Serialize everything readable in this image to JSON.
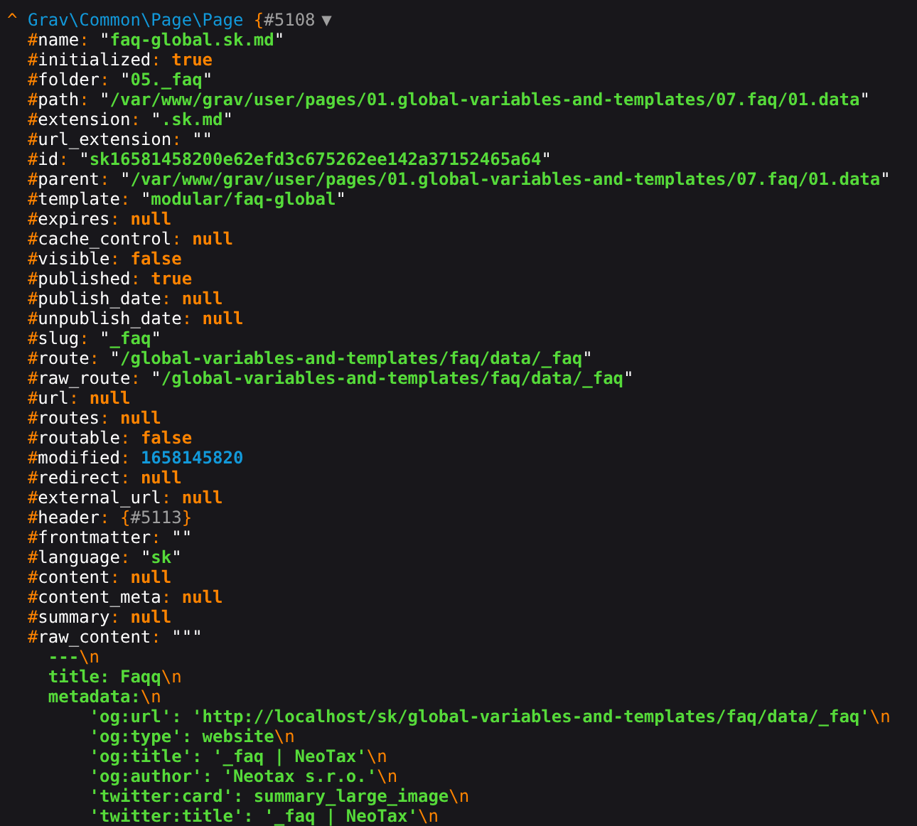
{
  "dump": {
    "caret": "^",
    "class": "Grav\\Common\\Page\\Page",
    "ref": "{#5108",
    "toggle": "▼",
    "properties": [
      {
        "key": "#name:",
        "value": "\"faq-global.sk.md\"",
        "kind": "string"
      },
      {
        "key": "#initialized:",
        "value": "true",
        "kind": "const"
      },
      {
        "key": "#folder:",
        "value": "\"05._faq\"",
        "kind": "string"
      },
      {
        "key": "#path:",
        "value": "\"/var/www/grav/user/pages/01.global-variables-and-templates/07.faq/01.data\"",
        "kind": "string"
      },
      {
        "key": "#extension:",
        "value": "\".sk.md\"",
        "kind": "string"
      },
      {
        "key": "#url_extension:",
        "value": "\"\"",
        "kind": "string"
      },
      {
        "key": "#id:",
        "value": "\"sk16581458200e62efd3c675262ee142a37152465a64\"",
        "kind": "string"
      },
      {
        "key": "#parent:",
        "value": "\"/var/www/grav/user/pages/01.global-variables-and-templates/07.faq/01.data\"",
        "kind": "string"
      },
      {
        "key": "#template:",
        "value": "\"modular/faq-global\"",
        "kind": "string"
      },
      {
        "key": "#expires:",
        "value": "null",
        "kind": "const"
      },
      {
        "key": "#cache_control:",
        "value": "null",
        "kind": "const"
      },
      {
        "key": "#visible:",
        "value": "false",
        "kind": "const"
      },
      {
        "key": "#published:",
        "value": "true",
        "kind": "const"
      },
      {
        "key": "#publish_date:",
        "value": "null",
        "kind": "const"
      },
      {
        "key": "#unpublish_date:",
        "value": "null",
        "kind": "const"
      },
      {
        "key": "#slug:",
        "value": "\"_faq\"",
        "kind": "string"
      },
      {
        "key": "#route:",
        "value": "\"/global-variables-and-templates/faq/data/_faq\"",
        "kind": "string"
      },
      {
        "key": "#raw_route:",
        "value": "\"/global-variables-and-templates/faq/data/_faq\"",
        "kind": "string"
      },
      {
        "key": "#url:",
        "value": "null",
        "kind": "const"
      },
      {
        "key": "#routes:",
        "value": "null",
        "kind": "const"
      },
      {
        "key": "#routable:",
        "value": "false",
        "kind": "const"
      },
      {
        "key": "#modified:",
        "value": "1658145820",
        "kind": "number"
      },
      {
        "key": "#redirect:",
        "value": "null",
        "kind": "const"
      },
      {
        "key": "#external_url:",
        "value": "null",
        "kind": "const"
      },
      {
        "key": "#header:",
        "value": "{#5113}",
        "kind": "ref"
      },
      {
        "key": "#frontmatter:",
        "value": "\"\"",
        "kind": "string"
      },
      {
        "key": "#language:",
        "value": "\"sk\"",
        "kind": "string"
      },
      {
        "key": "#content:",
        "value": "null",
        "kind": "const"
      },
      {
        "key": "#content_meta:",
        "value": "null",
        "kind": "const"
      },
      {
        "key": "#summary:",
        "value": "null",
        "kind": "const"
      },
      {
        "key": "#raw_content:",
        "value": "\"\"\"",
        "kind": "multiline",
        "lines": [
          {
            "text": "---\\n"
          },
          {
            "text": "title: Faqq\\n"
          },
          {
            "text": "metadata:\\n",
            "children": [
              {
                "text": "'og:url': 'http://localhost/sk/global-variables-and-templates/faq/data/_faq'\\n"
              },
              {
                "text": "'og:type': website\\n"
              },
              {
                "text": "'og:title': '_faq | NeoTax'\\n"
              },
              {
                "text": "'og:author': 'Neotax s.r.o.'\\n"
              },
              {
                "text": "'twitter:card': summary_large_image\\n"
              },
              {
                "text": "'twitter:title': '_faq | NeoTax'\\n"
              }
            ]
          }
        ]
      }
    ]
  }
}
